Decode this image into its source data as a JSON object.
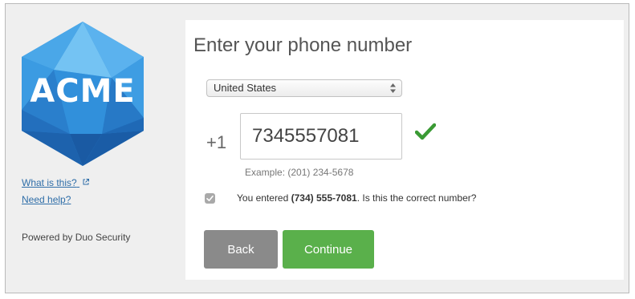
{
  "brand": {
    "logo_text": "ACME"
  },
  "sidebar": {
    "what_is_this": "What is this?",
    "need_help": "Need help?",
    "powered_by": "Powered by Duo Security"
  },
  "main": {
    "title": "Enter your phone number",
    "country_select": {
      "selected": "United States"
    },
    "country_code": "+1",
    "phone_input": {
      "value": "7345557081"
    },
    "example": "Example: (201) 234-5678",
    "confirmation": {
      "checked": true,
      "prefix": "You entered ",
      "number": "(734) 555-7081",
      "suffix": ". Is this the correct number?"
    },
    "buttons": {
      "back": "Back",
      "continue": "Continue"
    }
  },
  "colors": {
    "link": "#2f6ea8",
    "continue_button": "#5ab04b",
    "back_button": "#8a8a8a",
    "valid_check": "#3a9a34",
    "logo_primary": "#2f8fd8"
  }
}
